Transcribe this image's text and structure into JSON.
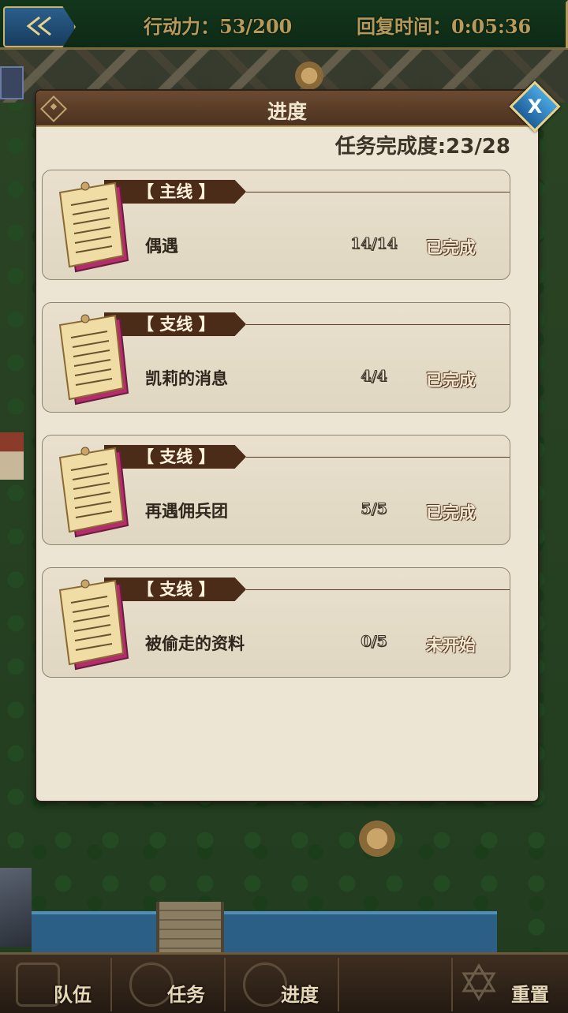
{
  "topbar": {
    "action_points": "行动力：53/200",
    "recover_time": "回复时间：0:05:36"
  },
  "panel": {
    "title": "进度",
    "completion": "任务完成度:23/28",
    "close_label": "X"
  },
  "quests": [
    {
      "tag": "【 主线 】",
      "name": "偶遇",
      "count": "14/14",
      "status": "已完成"
    },
    {
      "tag": "【 支线 】",
      "name": "凯莉的消息",
      "count": "4/4",
      "status": "已完成"
    },
    {
      "tag": "【 支线 】",
      "name": "再遇佣兵团",
      "count": "5/5",
      "status": "已完成"
    },
    {
      "tag": "【 支线 】",
      "name": "被偷走的资料",
      "count": "0/5",
      "status": "未开始"
    }
  ],
  "bottom_nav": {
    "team": "队伍",
    "quests": "任务",
    "progress": "进度",
    "reset": "重置"
  },
  "icons": {
    "back": "back-arrow-icon",
    "close": "close-icon",
    "scroll": "quest-scroll-icon"
  }
}
